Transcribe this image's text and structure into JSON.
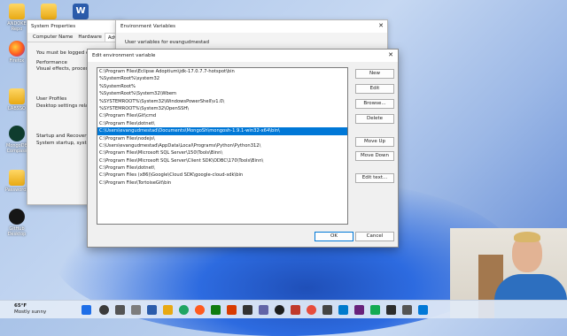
{
  "desktop_icons": [
    {
      "label": "ANDOKE Repo",
      "kind": "folder"
    },
    {
      "label": "",
      "kind": "folder"
    },
    {
      "label": "",
      "kind": "word"
    },
    {
      "label": "Firefox",
      "kind": "firefox"
    },
    {
      "label": "",
      "kind": "folder"
    },
    {
      "label": "LABSSO",
      "kind": "folder"
    },
    {
      "label": "MongoDB Compass",
      "kind": "mongo"
    },
    {
      "label": "",
      "kind": "folder"
    },
    {
      "label": "Passwords",
      "kind": "app"
    },
    {
      "label": "GitHub Desktop",
      "kind": "github"
    }
  ],
  "system_properties": {
    "title": "System Properties",
    "tabs": [
      "Computer Name",
      "Hardware",
      "Advance"
    ],
    "logon_text": "You must be logged on",
    "performance_label": "Performance",
    "performance_desc": "Visual effects, processo",
    "user_profiles_label": "User Profiles",
    "user_profiles_desc": "Desktop settings relate",
    "startup_label": "Startup and Recovery",
    "startup_desc": "System startup, system"
  },
  "environment_variables": {
    "title": "Environment Variables",
    "user_vars_label": "User variables for evangudmestad"
  },
  "edit_dialog": {
    "title": "Edit environment variable",
    "selected_index": 8,
    "entries": [
      "C:\\Program Files\\Eclipse Adoptium\\jdk-17.0.7.7-hotspot\\bin",
      "%SystemRoot%\\system32",
      "%SystemRoot%",
      "%SystemRoot%\\System32\\Wbem",
      "%SYSTEMROOT%\\System32\\WindowsPowerShell\\v1.0\\",
      "%SYSTEMROOT%\\System32\\OpenSSH\\",
      "C:\\Program Files\\Git\\cmd",
      "C:\\Program Files\\dotnet\\",
      "C:\\Users\\evangudmestad\\Documents\\MongoSh\\mongosh-1.9.1-win32-x64\\bin\\",
      "C:\\Program Files\\nodejs\\",
      "C:\\Users\\evangudmestad\\AppData\\Local\\Programs\\Python\\Python312\\",
      "C:\\Program Files\\Microsoft SQL Server\\150\\Tools\\Binn\\",
      "C:\\Program Files\\Microsoft SQL Server\\Client SDK\\ODBC\\170\\Tools\\Binn\\",
      "C:\\Program Files\\dotnet\\",
      "C:\\Program Files (x86)\\Google\\Cloud SDK\\google-cloud-sdk\\bin",
      "C:\\Program Files\\TortoiseGit\\bin"
    ],
    "buttons": {
      "new": "New",
      "edit": "Edit",
      "browse": "Browse...",
      "delete": "Delete",
      "move_up": "Move Up",
      "move_down": "Move Down",
      "edit_text": "Edit text...",
      "ok": "OK",
      "cancel": "Cancel"
    }
  },
  "taskbar": {
    "temperature": "65°F",
    "condition": "Mostly sunny",
    "weather_badge": "1"
  },
  "colors": {
    "selection": "#0078d7",
    "accent_blue": "#2d6fbf"
  }
}
